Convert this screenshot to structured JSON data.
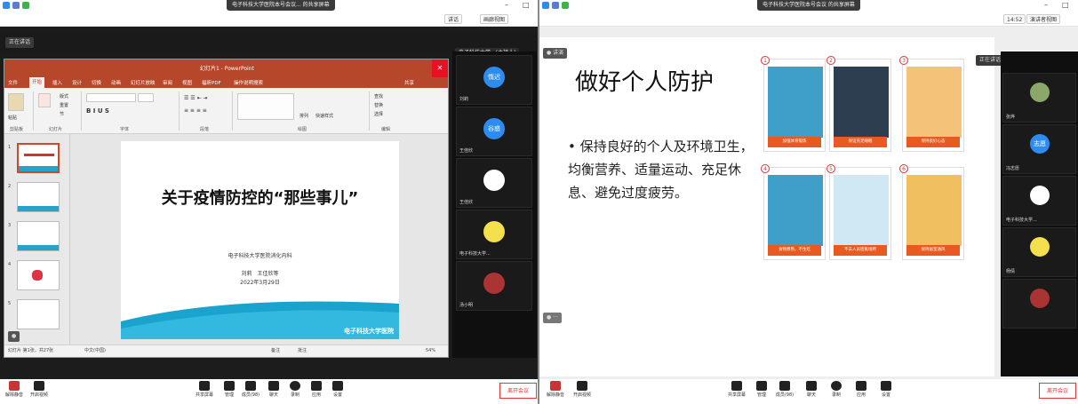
{
  "left": {
    "title_caption": "电子科技大学医院本号会议... 的共享屏幕",
    "toolbar": {
      "speaker": "讲话",
      "gallery": "画廊视图",
      "speaker_view": "演讲者视图"
    },
    "sharing_tag": "正在讲话",
    "ppt": {
      "title": "幻灯片1 - PowerPoint",
      "tabs": [
        "文件",
        "开始",
        "插入",
        "设计",
        "切换",
        "动画",
        "幻灯片放映",
        "审阅",
        "视图",
        "福昕PDF",
        "操作说明搜索"
      ],
      "share": "共享",
      "ribbon_groups": [
        "剪贴板",
        "幻灯片",
        "字体",
        "段落",
        "绘图",
        "编辑"
      ],
      "ribbon_labels": [
        "粘贴",
        "新建\n幻灯片",
        "版式",
        "重置",
        "节",
        "查找",
        "替换",
        "选择",
        "形状",
        "排列",
        "快速样式"
      ],
      "thumb_numbers": [
        "1",
        "2",
        "3",
        "4",
        "5"
      ],
      "slide_title": "关于疫情防控的“那些事儿”",
      "slide_org": "电子科技大学医院消化内科",
      "slide_author": "刘莉　王佳欣等",
      "slide_date": "2022年3月29日",
      "logo_text": "电子科技大学医院",
      "status_left": "幻灯片 第1张，共27张",
      "status_lang": "中文(中国)",
      "status_notes": "备注",
      "status_comments": "批注",
      "zoom": "54%"
    },
    "participants": [
      {
        "name": "电子科技大学...(主持人)",
        "avatar": ""
      },
      {
        "name": "刘莉",
        "avatar": "惰迟"
      },
      {
        "name": "王佳欣",
        "avatar": "谷惑"
      },
      {
        "name": "王佳欣",
        "avatar": ""
      },
      {
        "name": "电子科技大学...",
        "avatar": ""
      },
      {
        "name": "汤小明",
        "avatar": ""
      }
    ],
    "controls": [
      "解除静音",
      "开启视频",
      "共享屏幕",
      "管理",
      "成员(98)",
      "聊天",
      "录制",
      "应用",
      "设置"
    ],
    "leave": "离开会议"
  },
  "right": {
    "title_caption": "电子科技大学医院本号会议 的共享屏幕",
    "time": "14:52",
    "view": "演讲者视图",
    "sharing_tag": "正在讲话: 电子科技大学...",
    "slide_title": "做好个人防护",
    "bullet": "保持良好的个人及环境卫生，均衡营养、适量运动、充足休息、避免过度疲劳。",
    "illustrations": [
      {
        "num": "1",
        "caption": "加强体育锻炼"
      },
      {
        "num": "2",
        "caption": "保证充足睡眠"
      },
      {
        "num": "3",
        "caption": "保持良好心态"
      },
      {
        "num": "4",
        "caption": "食物煮熟，不生吃"
      },
      {
        "num": "5",
        "caption": "不去人员密集场所"
      },
      {
        "num": "6",
        "caption": "保持居室通风"
      }
    ],
    "participants": [
      {
        "name": "电子科技大学...(主持人)",
        "avatar": ""
      },
      {
        "name": "张烨",
        "avatar": ""
      },
      {
        "name": "冯志愿",
        "avatar": "志愿"
      },
      {
        "name": "电子科技大学...",
        "avatar": ""
      },
      {
        "name": "杨倩",
        "avatar": ""
      },
      {
        "name": "",
        "avatar": ""
      }
    ],
    "controls": [
      "解除静音",
      "开启视频",
      "共享屏幕",
      "管理",
      "成员(98)",
      "聊天",
      "录制",
      "应用",
      "设置"
    ],
    "leave": "离开会议"
  }
}
